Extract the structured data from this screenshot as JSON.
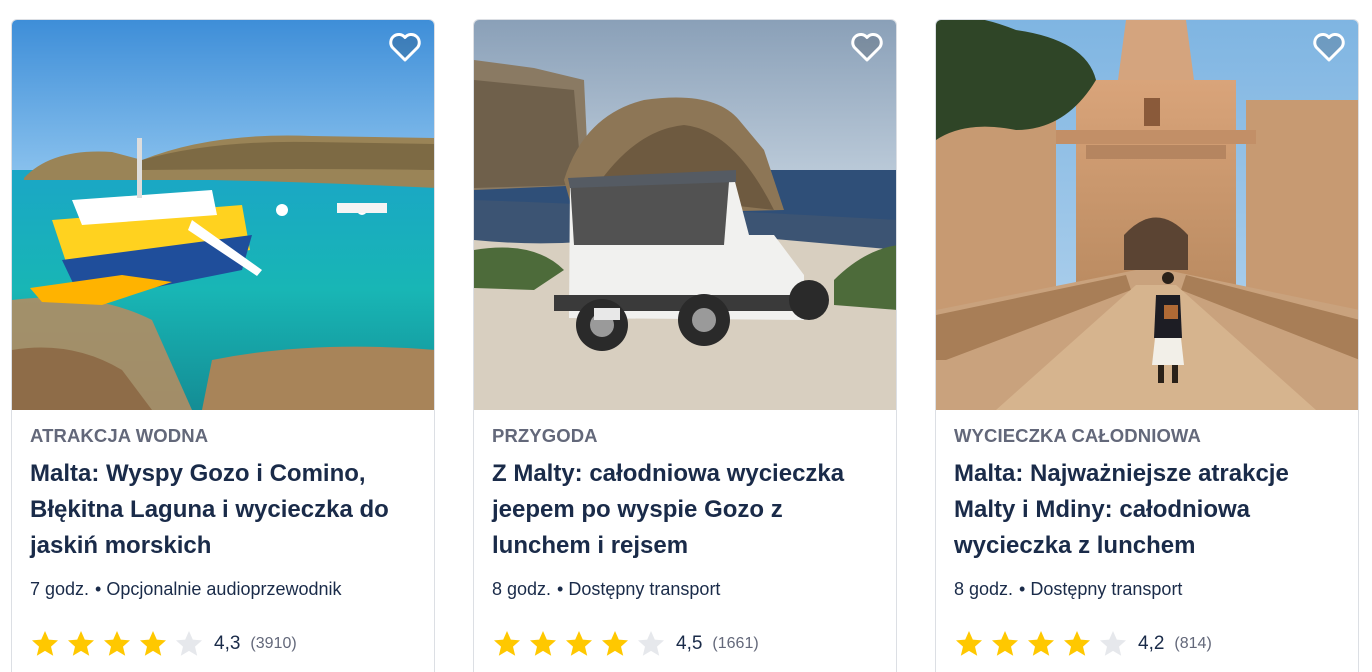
{
  "cards": [
    {
      "category": "ATRAKCJA WODNA",
      "title": "Malta: Wyspy Gozo i Comino, Błękitna Laguna i wycieczka do jaskiń morskich",
      "duration": "7 godz.",
      "feature": "Opcjonalnie audioprzewodnik",
      "rating": "4,3",
      "rating_value": 4.3,
      "reviews": "(3910)",
      "image": "blue-lagoon-boat-photo"
    },
    {
      "category": "PRZYGODA",
      "title": "Z Malty: całodniowa wycieczka jeepem po wyspie Gozo z lunchem i rejsem",
      "duration": "8 godz.",
      "feature": "Dostępny transport",
      "rating": "4,5",
      "rating_value": 4.5,
      "reviews": "(1661)",
      "image": "gozo-jeep-photo"
    },
    {
      "category": "WYCIECZKA CAŁODNIOWA",
      "title": "Malta: Najważniejsze atrakcje Malty i Mdiny: całodniowa wycieczka z lunchem",
      "duration": "8 godz.",
      "feature": "Dostępny transport",
      "rating": "4,2",
      "rating_value": 4.2,
      "reviews": "(814)",
      "image": "mdina-gate-photo"
    }
  ],
  "separator": "•",
  "colors": {
    "star_filled": "#ffc800",
    "star_empty": "#e6e8ec",
    "title": "#1a2b49",
    "category": "#63687a"
  },
  "icons": {
    "wishlist": "heart-outline-icon",
    "rating": "star-icon"
  }
}
